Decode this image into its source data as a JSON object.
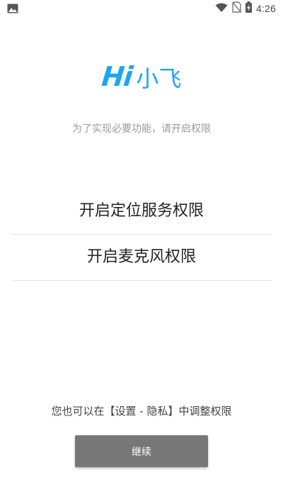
{
  "status_bar": {
    "time": "4:26",
    "icons": [
      "image-icon",
      "wifi-icon",
      "no-sim-icon",
      "battery-charging-icon"
    ]
  },
  "logo": {
    "prefix": "Hi",
    "name": "小飞",
    "color": "#1aa7f0"
  },
  "subtitle": "为了实现必要功能，请开启权限",
  "permissions": [
    {
      "label": "开启定位服务权限"
    },
    {
      "label": "开启麦克风权限"
    }
  ],
  "notice": "您也可以在【设置 - 隐私】中调整权限",
  "continue_button": {
    "label": "继续",
    "background": "#777777"
  }
}
